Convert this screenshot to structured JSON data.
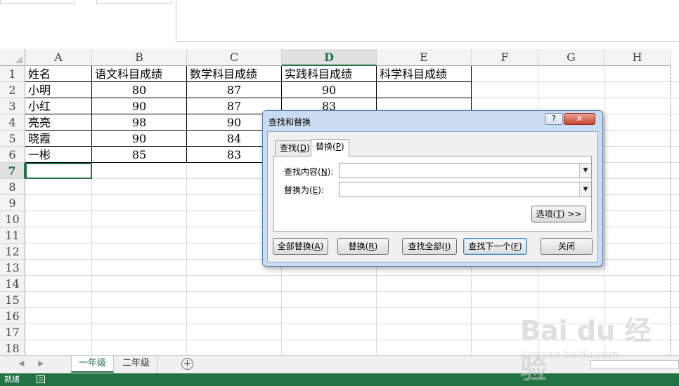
{
  "spreadsheet": {
    "columns": [
      "A",
      "B",
      "C",
      "D",
      "E",
      "F",
      "G",
      "H"
    ],
    "selected_column": "D",
    "rows": [
      "1",
      "2",
      "3",
      "4",
      "5",
      "6",
      "7",
      "8",
      "9",
      "10",
      "11",
      "12",
      "13",
      "14",
      "15",
      "16",
      "17",
      "18"
    ],
    "selected_row": "7",
    "headers": [
      "姓名",
      "语文科目成绩",
      "数学科目成绩",
      "实践科目成绩",
      "科学科目成绩"
    ],
    "data": [
      [
        "小明",
        "80",
        "87",
        "90"
      ],
      [
        "小红",
        "90",
        "87",
        "83"
      ],
      [
        "亮亮",
        "98",
        "90",
        ""
      ],
      [
        "晓霞",
        "90",
        "84",
        ""
      ],
      [
        "一彬",
        "85",
        "83",
        ""
      ]
    ]
  },
  "sheets": {
    "tabs": [
      "一年级",
      "二年级"
    ],
    "active": "一年级",
    "add_label": "+"
  },
  "status": {
    "text": "就绪"
  },
  "dialog": {
    "title": "查找和替换",
    "help_label": "?",
    "close_label": "✕",
    "tabs": {
      "find_text": "查找",
      "find_key": "D",
      "replace_text": "替换",
      "replace_key": "P"
    },
    "find_label_text": "查找内容",
    "find_label_key": "N",
    "find_value": "",
    "replace_label_text": "替换为",
    "replace_label_key": "E",
    "replace_value": "",
    "options_text": "选项",
    "options_key": "T",
    "options_suffix": " >>",
    "buttons": {
      "replace_all_text": "全部替换",
      "replace_all_key": "A",
      "replace_text": "替换",
      "replace_key": "R",
      "find_all_text": "查找全部",
      "find_all_key": "I",
      "find_next_text": "查找下一个",
      "find_next_key": "F",
      "close_text": "关闭"
    }
  },
  "watermark": {
    "logo": "Bai du 经验",
    "url": "jingyan.baidu.com"
  }
}
